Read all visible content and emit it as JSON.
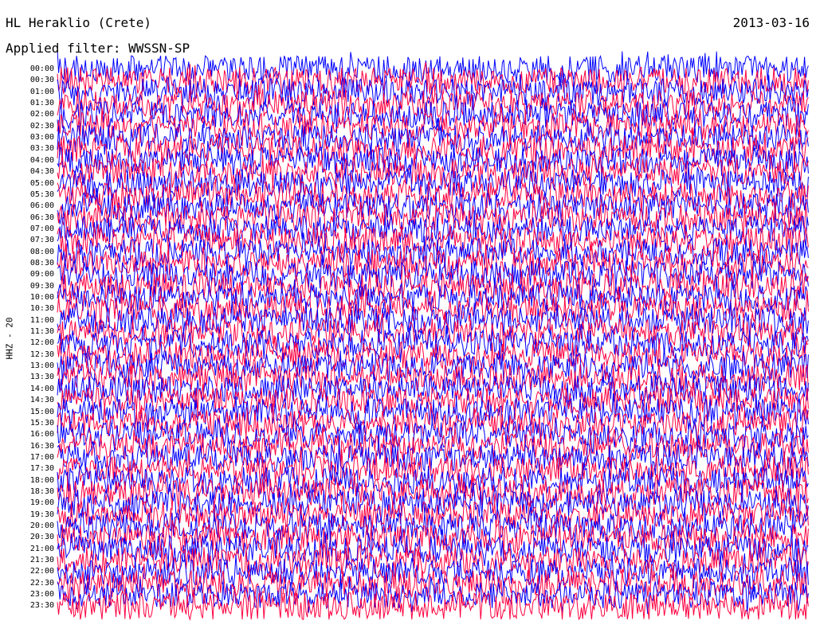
{
  "header": {
    "station": "HL Heraklio (Crete)",
    "date": "2013-03-16",
    "filter": "Applied filter: WWSSN-SP"
  },
  "axis": {
    "channel_label": "HHZ - 20"
  },
  "colors": {
    "trace_a": "#0000ff",
    "trace_b": "#ff0040",
    "background": "#ffffff",
    "text": "#000000"
  },
  "chart_data": {
    "type": "line",
    "description_kind": "helicorder",
    "y_labels": [
      "00:00",
      "00:30",
      "01:00",
      "01:30",
      "02:00",
      "02:30",
      "03:00",
      "03:30",
      "04:00",
      "04:30",
      "05:00",
      "05:30",
      "06:00",
      "06:30",
      "07:00",
      "07:30",
      "08:00",
      "08:30",
      "09:00",
      "09:30",
      "10:00",
      "10:30",
      "11:00",
      "11:30",
      "12:00",
      "12:30",
      "13:00",
      "13:30",
      "14:00",
      "14:30",
      "15:00",
      "15:30",
      "16:00",
      "16:30",
      "17:00",
      "17:30",
      "18:00",
      "18:30",
      "19:00",
      "19:30",
      "20:00",
      "20:30",
      "21:00",
      "21:30",
      "22:00",
      "22:30",
      "23:00",
      "23:30"
    ],
    "series": [
      {
        "color": "blue"
      },
      {
        "color": "red"
      }
    ],
    "legend": "none",
    "grid": false
  }
}
